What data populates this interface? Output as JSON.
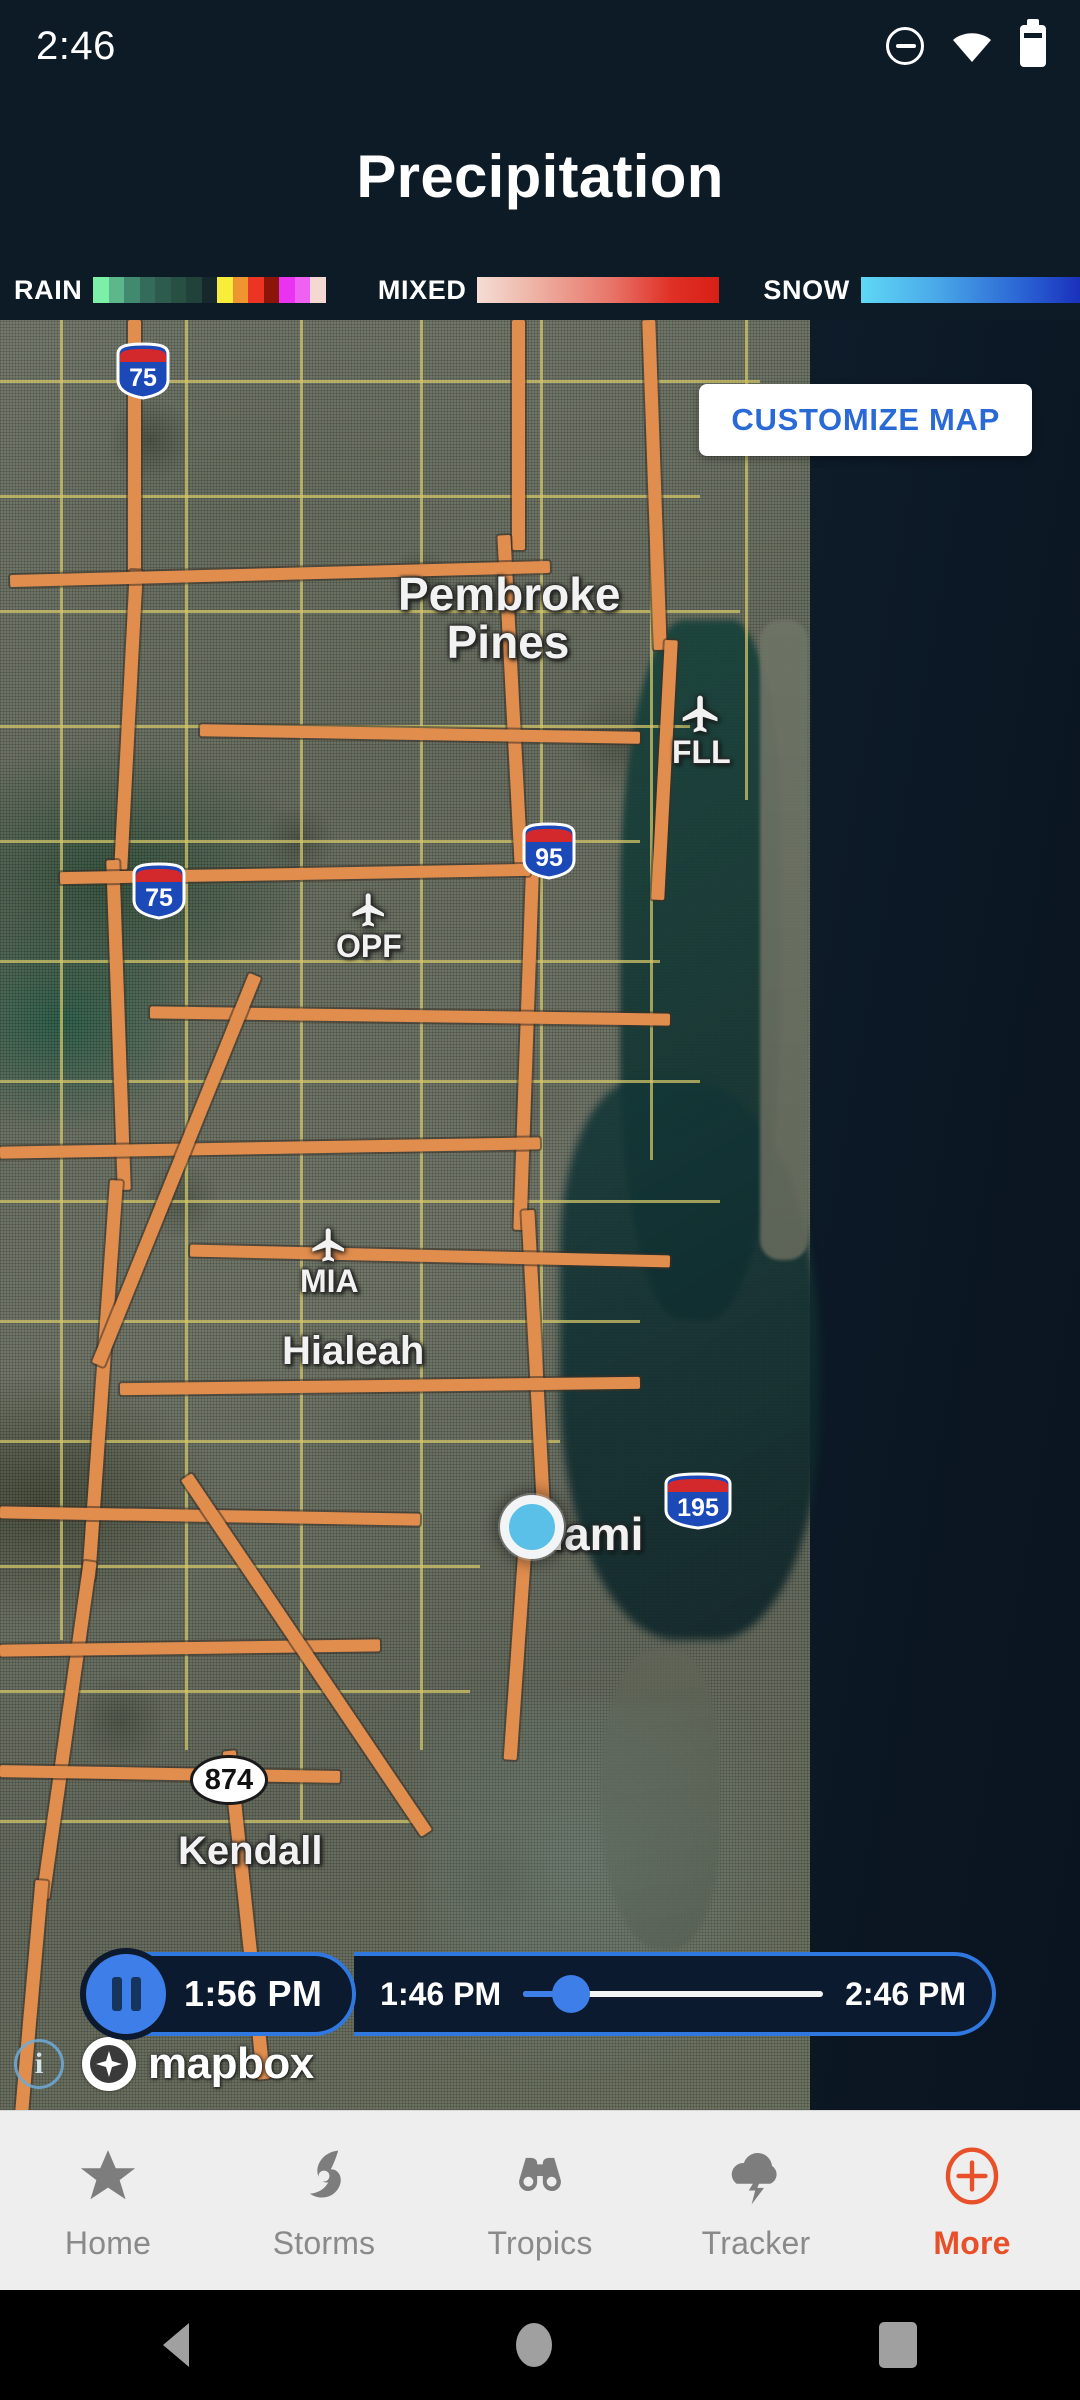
{
  "statusbar": {
    "time": "2:46",
    "icons": [
      "do-not-disturb-icon",
      "wifi-icon",
      "battery-icon"
    ]
  },
  "header": {
    "title": "Precipitation",
    "background_color": "#0d1b26"
  },
  "legend": {
    "groups": [
      {
        "label": "RAIN",
        "type": "swatches",
        "colors": [
          "#7df0a8",
          "#5cb88a",
          "#418a70",
          "#356b5a",
          "#2d5c4e",
          "#275043",
          "#20423a",
          "#1a3330",
          "#17282c",
          "#f8ed3a",
          "#ef9530",
          "#ec3424",
          "#8a1508",
          "#e833f0",
          "#ef61f2",
          "#f4d9d2"
        ]
      },
      {
        "label": "MIXED",
        "type": "gradient",
        "colors": [
          "#f5ddd6",
          "#eeb6a8",
          "#e8766a",
          "#e03127",
          "#d81f16"
        ]
      },
      {
        "label": "SNOW",
        "type": "gradient",
        "colors": [
          "#5fd8f5",
          "#49a8e8",
          "#2a63d4",
          "#1420b4"
        ]
      }
    ]
  },
  "map": {
    "customize_button": "CUSTOMIZE MAP",
    "customize_button_color": "#2a6ad6",
    "attribution": {
      "info_icon": "info-icon",
      "provider": "mapbox"
    },
    "location_marker": {
      "name": "current-location-dot",
      "fill": "#5bc0e8",
      "ring": "#f2f4f6"
    },
    "city_labels": [
      {
        "name": "Pembroke Pines",
        "text": "Pembroke\nPines"
      },
      {
        "name": "Hialeah",
        "text": "Hialeah"
      },
      {
        "name": "Miami",
        "text": "Miami"
      },
      {
        "name": "Kendall",
        "text": "Kendall"
      }
    ],
    "airports": [
      {
        "code": "FLL"
      },
      {
        "code": "OPF"
      },
      {
        "code": "MIA"
      }
    ],
    "route_shields": [
      {
        "kind": "interstate",
        "number": "75"
      },
      {
        "kind": "interstate",
        "number": "95"
      },
      {
        "kind": "interstate",
        "number": "75"
      },
      {
        "kind": "interstate",
        "number": "195"
      },
      {
        "kind": "state",
        "number": "874"
      }
    ]
  },
  "timeline": {
    "play_state": "pause",
    "current_time": "1:56 PM",
    "start_time": "1:46 PM",
    "end_time": "2:46 PM",
    "progress_percent": 16,
    "accent_color": "#3d7ee8"
  },
  "bottomnav": {
    "items": [
      {
        "label": "Home",
        "icon": "star-icon",
        "active": false
      },
      {
        "label": "Storms",
        "icon": "hurricane-icon",
        "active": false
      },
      {
        "label": "Tropics",
        "icon": "binoculars-icon",
        "active": false
      },
      {
        "label": "Tracker",
        "icon": "storm-cloud-icon",
        "active": false
      },
      {
        "label": "More",
        "icon": "plus-circle-icon",
        "active": true
      }
    ],
    "active_color": "#e8502a",
    "inactive_color": "#8a8a8a"
  },
  "androidnav": {
    "buttons": [
      "back-button",
      "home-button",
      "recents-button"
    ]
  }
}
